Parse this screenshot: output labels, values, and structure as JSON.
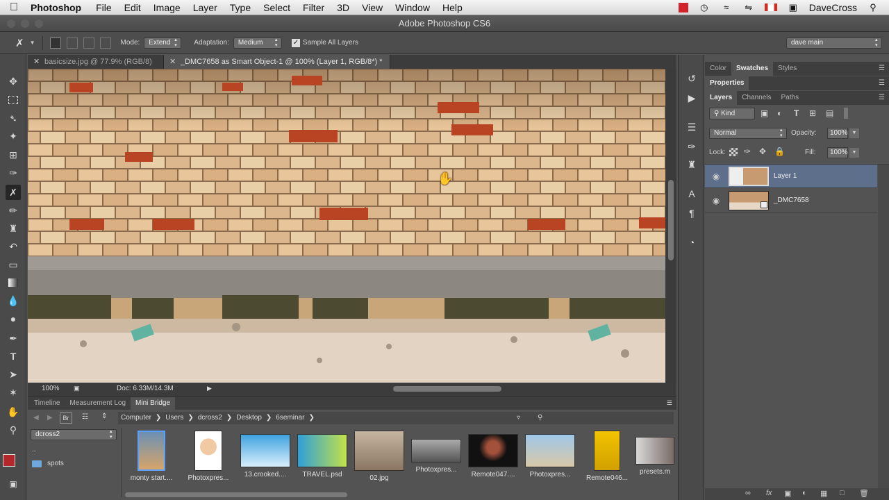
{
  "menubar": {
    "app": "Photoshop",
    "items": [
      "File",
      "Edit",
      "Image",
      "Layer",
      "Type",
      "Select",
      "Filter",
      "3D",
      "View",
      "Window",
      "Help"
    ],
    "user": "DaveCross"
  },
  "window": {
    "title": "Adobe Photoshop CS6"
  },
  "options": {
    "mode_label": "Mode:",
    "mode_value": "Extend",
    "adaptation_label": "Adaptation:",
    "adaptation_value": "Medium",
    "sample_all_layers": "Sample All Layers",
    "workspace": "dave main"
  },
  "doc_tabs": [
    {
      "label": "basicsize.jpg @ 77.9% (RGB/8) *"
    },
    {
      "label": "_DMC7658 as Smart Object-1 @ 100% (Layer 1, RGB/8*) *"
    }
  ],
  "status": {
    "zoom": "100%",
    "doc": "Doc: 6.33M/14.3M"
  },
  "bottom_tabs": [
    "Timeline",
    "Measurement Log",
    "Mini Bridge"
  ],
  "minibridge": {
    "breadcrumb": [
      "Computer",
      "Users",
      "dcross2",
      "Desktop",
      "6seminar"
    ],
    "location": "dcross2",
    "folders": [
      "..",
      "spots"
    ],
    "thumbnails": [
      "monty start....",
      "Photoxpres...",
      "13.crooked....",
      "TRAVEL.psd",
      "02.jpg",
      "Photoxpres...",
      "Remote047....",
      "Photoxpres...",
      "Remote046...",
      "presets.m"
    ]
  },
  "panels": {
    "top_tabs": [
      "Color",
      "Swatches",
      "Styles"
    ],
    "properties": "Properties",
    "layer_tabs": [
      "Layers",
      "Channels",
      "Paths"
    ],
    "kind": "Kind",
    "blend_mode": "Normal",
    "opacity_label": "Opacity:",
    "opacity": "100%",
    "lock_label": "Lock:",
    "fill_label": "Fill:",
    "fill": "100%",
    "layers": [
      {
        "name": "Layer 1",
        "selected": true
      },
      {
        "name": "_DMC7658",
        "selected": false
      }
    ]
  },
  "colors": {
    "foreground": "#b3262a",
    "background": "#111111",
    "selection": "#5e6f8c"
  }
}
